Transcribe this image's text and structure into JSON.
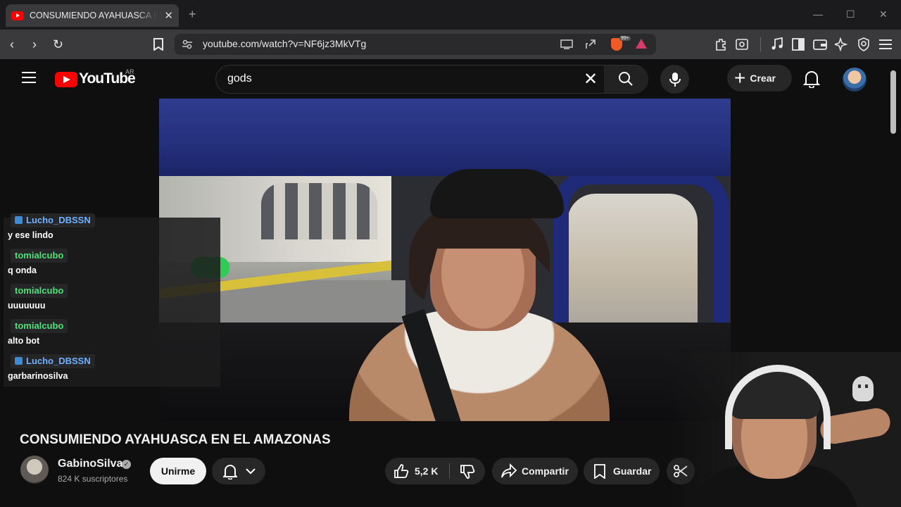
{
  "browser": {
    "tab_title": "CONSUMIENDO AYAHUASCA EN EL AMAZONAS",
    "url": "youtube.com/watch?v=NF6jz3MkVTg",
    "brave_badge": "99+"
  },
  "youtube": {
    "logo_text": "YouTube",
    "country_code": "AR",
    "search_value": "gods",
    "create_label": "Crear"
  },
  "chat": [
    {
      "user": "Lucho_DBSSN",
      "message": "y ese lindo",
      "color": "#6fb0ff"
    },
    {
      "user": "tomialcubo",
      "message": "q onda",
      "color": "#52e07a"
    },
    {
      "user": "tomialcubo",
      "message": "uuuuuuu",
      "color": "#52e07a"
    },
    {
      "user": "tomialcubo",
      "message": "alto bot",
      "color": "#52e07a"
    },
    {
      "user": "Lucho_DBSSN",
      "message": "garbarinosilva",
      "color": "#6fb0ff"
    }
  ],
  "video": {
    "title": "CONSUMIENDO AYAHUASCA EN EL AMAZONAS",
    "channel_name": "GabinoSilva",
    "subscribers": "824 K suscriptores",
    "join_label": "Unirme",
    "like_count": "5,2 K",
    "share_label": "Compartir",
    "save_label": "Guardar"
  },
  "icons": [
    "back-icon",
    "forward-icon",
    "reload-icon",
    "bookmark-icon",
    "site-info-icon",
    "cast-icon",
    "share-page-icon",
    "brave-shields-icon",
    "brave-rewards-icon",
    "extensions-icon",
    "screenshot-icon",
    "media-icon",
    "sidebar-icon",
    "wallet-icon",
    "leo-icon",
    "vpn-icon",
    "menu-icon",
    "hamburger-icon",
    "search-icon",
    "mic-icon",
    "bell-icon",
    "like-icon",
    "dislike-icon",
    "share-icon",
    "save-icon",
    "clip-icon"
  ]
}
